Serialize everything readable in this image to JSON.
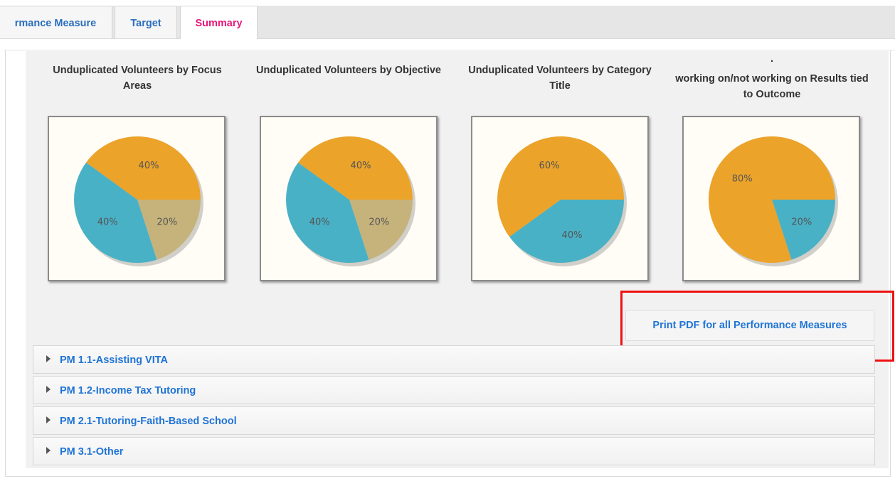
{
  "tabs": [
    {
      "label": "rmance Measure",
      "active": false
    },
    {
      "label": "Target",
      "active": false
    },
    {
      "label": "Summary",
      "active": true
    }
  ],
  "charts": [
    {
      "title": "Unduplicated Volunteers by Focus Areas",
      "chart_data": {
        "type": "pie",
        "values": [
          20,
          40,
          40
        ],
        "colors": [
          "#c6b37c",
          "#49b1c6",
          "#eba32a"
        ],
        "labels": [
          "20%",
          "40%",
          "40%"
        ]
      }
    },
    {
      "title": "Unduplicated Volunteers by Objective",
      "chart_data": {
        "type": "pie",
        "values": [
          20,
          40,
          40
        ],
        "colors": [
          "#c6b37c",
          "#49b1c6",
          "#eba32a"
        ],
        "labels": [
          "20%",
          "40%",
          "40%"
        ]
      }
    },
    {
      "title": "Unduplicated Volunteers by Category Title",
      "chart_data": {
        "type": "pie",
        "values": [
          40,
          60
        ],
        "colors": [
          "#49b1c6",
          "#eba32a"
        ],
        "labels": [
          "40%",
          "60%"
        ]
      }
    },
    {
      "title_prefix": ".",
      "title": "working on/not working on Results tied to Outcome",
      "chart_data": {
        "type": "pie",
        "values": [
          20,
          80
        ],
        "colors": [
          "#49b1c6",
          "#eba32a"
        ],
        "labels": [
          "20%",
          "80%"
        ]
      }
    }
  ],
  "print_button": {
    "label": "Print PDF for all Performance Measures"
  },
  "accordion": [
    {
      "label": "PM 1.1-Assisting VITA"
    },
    {
      "label": "PM 1.2-Income Tax Tutoring"
    },
    {
      "label": "PM 2.1-Tutoring-Faith-Based School"
    },
    {
      "label": "PM 3.1-Other"
    }
  ]
}
